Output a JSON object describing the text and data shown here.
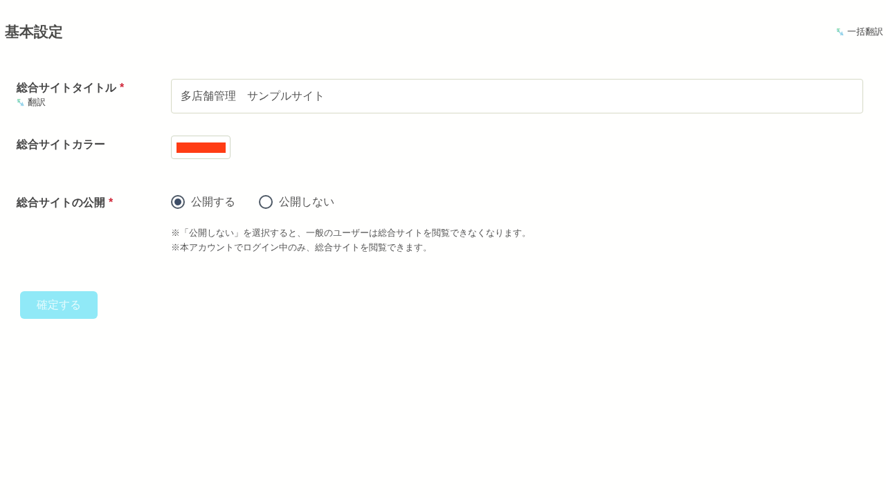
{
  "header": {
    "title": "基本設定",
    "bulk_translate": {
      "label": "一括翻訳"
    }
  },
  "fields": [
    {
      "kind": "text",
      "label": "総合サイトタイトル",
      "required_mark": "*",
      "translate": {
        "label": "翻訳"
      },
      "value": "多店舗管理　サンプルサイト"
    },
    {
      "kind": "color",
      "label": "総合サイトカラー",
      "color": "#ff3c14"
    },
    {
      "kind": "radio",
      "label": "総合サイトの公開",
      "required_mark": "*",
      "options": [
        {
          "label": "公開する",
          "selected": true
        },
        {
          "label": "公開しない",
          "selected": false
        }
      ],
      "notes": [
        "※「公開しない」を選択すると、一般のユーザーは総合サイトを閲覧できなくなります。",
        "※本アカウントでログイン中のみ、総合サイトを閲覧できます。"
      ]
    }
  ],
  "submit_button": {
    "label": "確定する",
    "disabled": true
  }
}
